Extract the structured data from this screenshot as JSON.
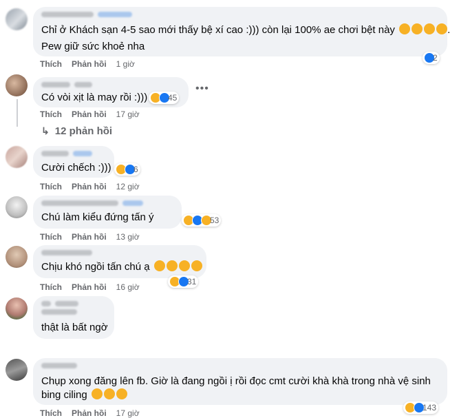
{
  "actions": {
    "like": "Thích",
    "reply": "Phản hồi"
  },
  "comments": [
    {
      "text_lines": [
        "Chỉ ở Khách sạn 4-5 sao mới thấy bệ xí cao :))) còn lại 100% ae chơi bệt này",
        "Pew giữ sức khoẻ nha"
      ],
      "time": "1 giờ",
      "reaction_count": "2",
      "reactions": [
        "like"
      ],
      "inline_emojis": [
        "rolling-on-floor-laughing",
        "rolling-on-floor-laughing",
        "rolling-on-floor-laughing",
        "rolling-on-floor-laughing"
      ]
    },
    {
      "text_lines": [
        "Có vòi xịt là may rồi :)))"
      ],
      "time": "17 giờ",
      "reaction_count": "45",
      "reactions": [
        "haha",
        "like"
      ]
    },
    {
      "text_lines": [
        "Cười chếch :)))"
      ],
      "time": "12 giờ",
      "reaction_count": "6",
      "reactions": [
        "haha",
        "like"
      ]
    },
    {
      "text_lines": [
        "Chú làm kiểu đứng tấn ý"
      ],
      "time": "13 giờ",
      "reaction_count": "53",
      "reactions": [
        "haha",
        "like",
        "sad"
      ]
    },
    {
      "text_lines": [
        "Chịu khó ngồi tấn chú ạ"
      ],
      "time": "16 giờ",
      "reaction_count": "31",
      "reactions": [
        "haha",
        "like"
      ],
      "inline_emojis": [
        "rolling-on-floor-laughing",
        "rolling-on-floor-laughing",
        "rolling-on-floor-laughing",
        "rolling-on-floor-laughing"
      ]
    },
    {
      "text_lines": [
        "thật là bất ngờ"
      ]
    },
    {
      "text_lines": [
        "Chụp xong đăng lên fb. Giờ là đang ngồi ị rồi đọc cmt cười khà khà trong nhà vệ sinh",
        "bing ciling"
      ],
      "time": "17 giờ",
      "reaction_count": "143",
      "reactions": [
        "haha",
        "like"
      ],
      "inline_emojis": [
        "grinning-squinting-face",
        "grinning-squinting-face",
        "grinning-squinting-face"
      ]
    }
  ],
  "view_replies": "12 phản hồi",
  "colors": {
    "bubble": "#f0f2f5",
    "secondary_text": "#65676b",
    "like_blue": "#1877f2",
    "haha_yellow": "#f7b125"
  }
}
